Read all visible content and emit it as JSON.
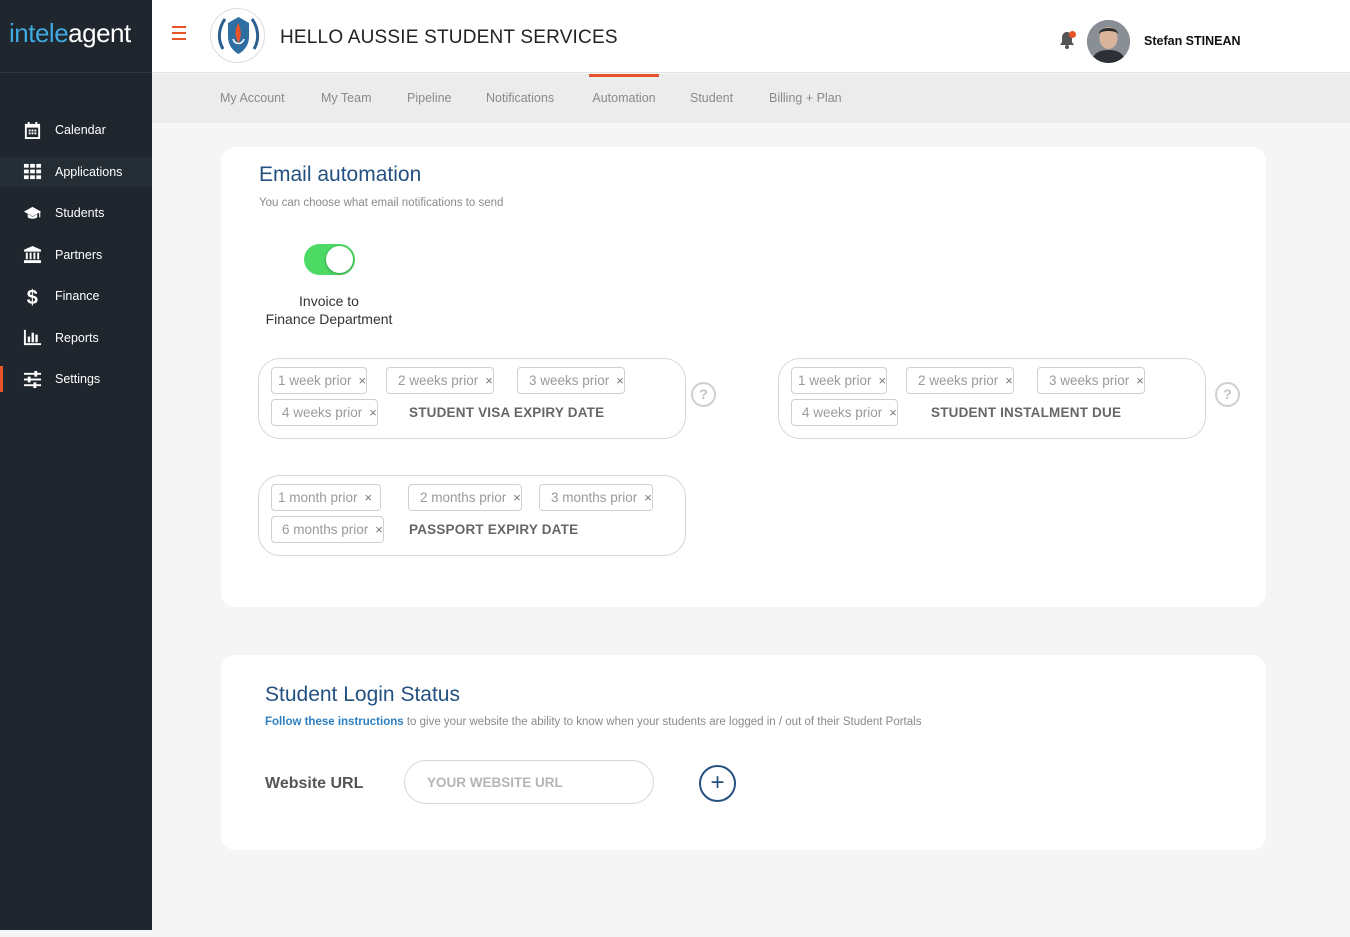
{
  "app": {
    "logo_part1": "intele",
    "logo_part2": "agent",
    "title": "HELLO AUSSIE STUDENT SERVICES",
    "user_name": "Stefan STINEAN"
  },
  "sidebar": {
    "items": [
      {
        "label": "Calendar",
        "icon": "calendar-icon"
      },
      {
        "label": "Applications",
        "icon": "grid-icon"
      },
      {
        "label": "Students",
        "icon": "graduation-cap-icon"
      },
      {
        "label": "Partners",
        "icon": "bank-icon"
      },
      {
        "label": "Finance",
        "icon": "dollar-icon"
      },
      {
        "label": "Reports",
        "icon": "bar-chart-icon"
      },
      {
        "label": "Settings",
        "icon": "sliders-icon"
      }
    ]
  },
  "tabs": [
    "My Account",
    "My Team",
    "Pipeline",
    "Notifications",
    "Automation",
    "Student",
    "Billing + Plan"
  ],
  "active_tab": "Automation",
  "email_automation": {
    "title": "Email automation",
    "subtitle": "You can choose what email notifications to send",
    "toggle_label_line1": "Invoice to",
    "toggle_label_line2": "Finance Department",
    "toggle_on": true,
    "boxes": [
      {
        "label": "STUDENT VISA EXPIRY DATE",
        "chips": [
          "1 week prior",
          "2 weeks prior",
          "3 weeks prior",
          "4 weeks prior"
        ]
      },
      {
        "label": "STUDENT INSTALMENT DUE",
        "chips": [
          "1 week prior",
          "2 weeks prior",
          "3 weeks prior",
          "4 weeks prior"
        ]
      },
      {
        "label": "PASSPORT EXPIRY DATE",
        "chips": [
          "1 month prior",
          "2 months prior",
          "3 months prior",
          "6 months prior"
        ]
      }
    ],
    "help_glyph": "?",
    "chip_remove_glyph": "×"
  },
  "login_status": {
    "title": "Student Login Status",
    "link_text": "Follow these instructions",
    "instruction_text": " to give your website the ability to know when your students are logged in / out of their Student Portals",
    "url_label": "Website URL",
    "url_placeholder": "YOUR WEBSITE URL",
    "url_value": "",
    "add_glyph": "+"
  },
  "colors": {
    "accent": "#e8542a",
    "brand_blue": "#245180",
    "toggle_on": "#4cd964",
    "sidebar_bg": "#1f262d"
  }
}
